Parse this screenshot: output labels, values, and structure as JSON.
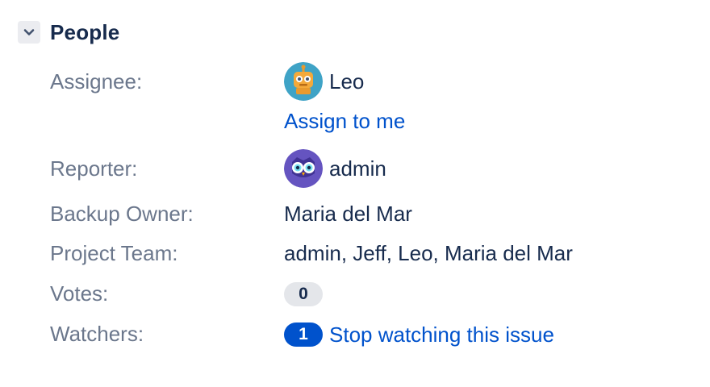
{
  "section": {
    "title": "People",
    "toggle_icon": "chevron-down-icon"
  },
  "assignee": {
    "label": "Assignee:",
    "name": "Leo",
    "avatar_icon": "robot-avatar-icon",
    "assign_link": "Assign to me"
  },
  "reporter": {
    "label": "Reporter:",
    "name": "admin",
    "avatar_icon": "owl-avatar-icon"
  },
  "backup_owner": {
    "label": "Backup Owner:",
    "value": "Maria del Mar"
  },
  "project_team": {
    "label": "Project Team:",
    "value": "admin, Jeff, Leo, Maria del Mar"
  },
  "votes": {
    "label": "Votes:",
    "count": "0"
  },
  "watchers": {
    "label": "Watchers:",
    "count": "1",
    "link": "Stop watching this issue"
  },
  "colors": {
    "link": "#0052cc",
    "label": "#6b778c",
    "text": "#172b4d",
    "badge_grey": "#e4e6ea",
    "badge_blue": "#0052cc"
  }
}
